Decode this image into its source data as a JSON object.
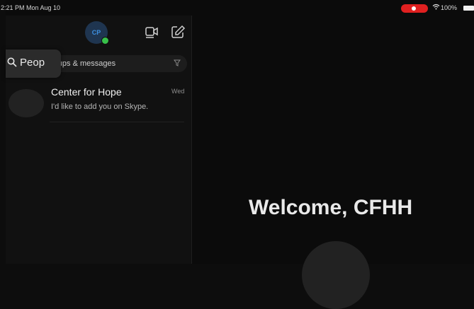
{
  "status_bar": {
    "time": "2:21 PM  Mon Aug 10",
    "battery": "100%"
  },
  "profile": {
    "initials": "CP",
    "presence_color": "#38c14a"
  },
  "toolbar": {
    "video_icon": "video-call-icon",
    "compose_icon": "compose-icon"
  },
  "search": {
    "tooltip_label": "Peop",
    "placeholder": "roups & messages",
    "filter_icon": "filter-icon"
  },
  "conversations": [
    {
      "name": "Center for Hope",
      "message": "I'd like to add you on Skype.",
      "time": "Wed"
    }
  ],
  "main": {
    "welcome": "Welcome, CFHH"
  },
  "colors": {
    "accent": "#3d8fe0",
    "record": "#e02020"
  }
}
